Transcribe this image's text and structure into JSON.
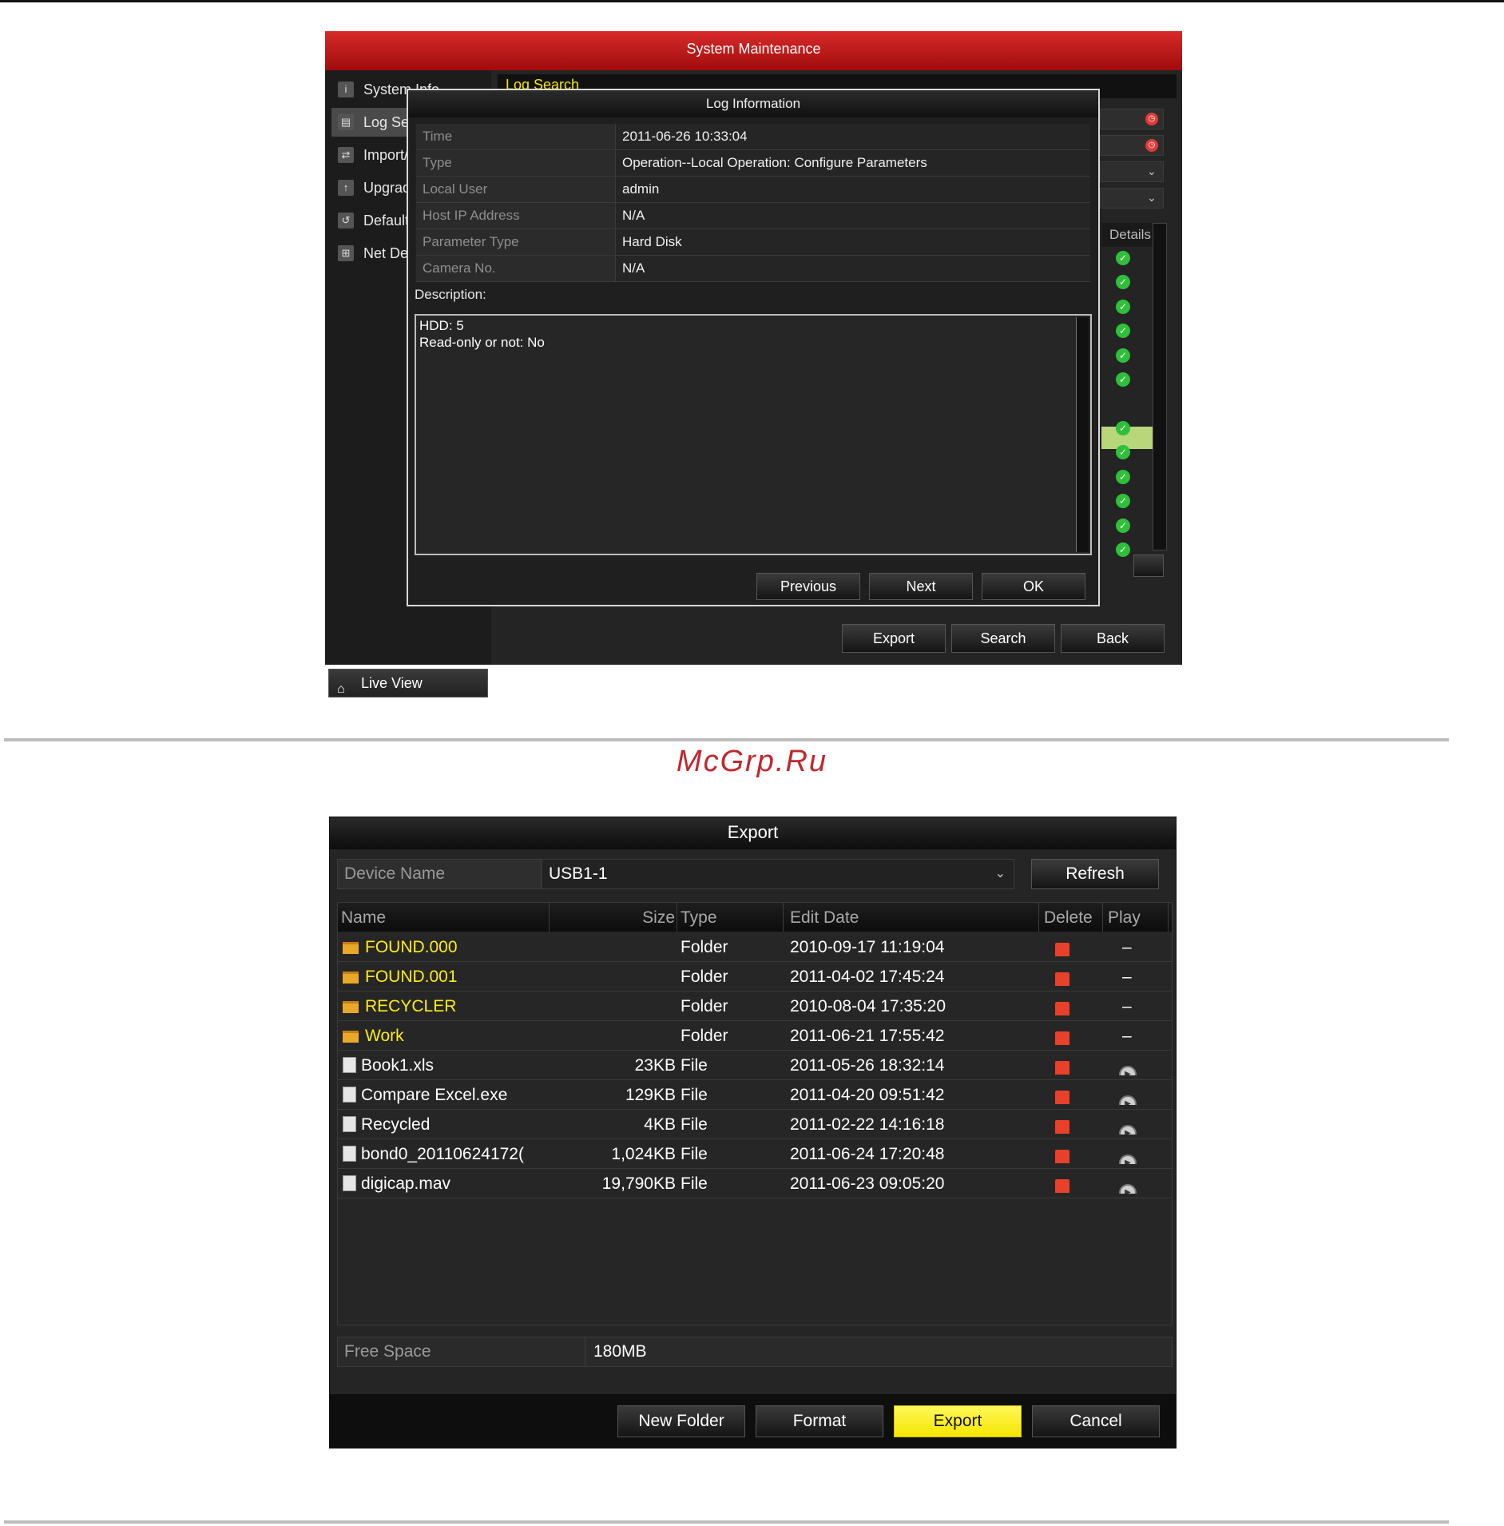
{
  "watermark": "McGrp.Ru",
  "system_maintenance": {
    "title": "System Maintenance",
    "sidebar": {
      "items": [
        {
          "label": "System Info",
          "icon": "info-icon"
        },
        {
          "label": "Log Search",
          "icon": "log-icon"
        },
        {
          "label": "Import/Export",
          "icon": "import-icon"
        },
        {
          "label": "Upgrade",
          "icon": "upgrade-icon"
        },
        {
          "label": "Default",
          "icon": "default-icon"
        },
        {
          "label": "Net Detect",
          "icon": "network-icon"
        }
      ],
      "live_view": "Live View"
    },
    "main_header": "Log Search",
    "details_header": "Details",
    "buttons": {
      "export": "Export",
      "search": "Search",
      "back": "Back"
    },
    "log_information": {
      "title": "Log Information",
      "fields": [
        {
          "key": "Time",
          "value": "2011-06-26 10:33:04"
        },
        {
          "key": "Type",
          "value": "Operation--Local Operation: Configure Parameters"
        },
        {
          "key": "Local User",
          "value": "admin"
        },
        {
          "key": "Host IP Address",
          "value": "N/A"
        },
        {
          "key": "Parameter Type",
          "value": "Hard Disk"
        },
        {
          "key": "Camera No.",
          "value": "N/A"
        }
      ],
      "description_label": "Description:",
      "description_lines": [
        "HDD: 5",
        "Read-only or not: No"
      ],
      "buttons": {
        "previous": "Previous",
        "next": "Next",
        "ok": "OK"
      }
    }
  },
  "export_dialog": {
    "title": "Export",
    "device_name_label": "Device Name",
    "device_name_value": "USB1-1",
    "refresh": "Refresh",
    "columns": {
      "name": "Name",
      "size": "Size",
      "type": "Type",
      "edit_date": "Edit Date",
      "delete": "Delete",
      "play": "Play"
    },
    "rows": [
      {
        "name": "FOUND.000",
        "size": "",
        "type": "Folder",
        "date": "2010-09-17 11:19:04",
        "kind": "folder"
      },
      {
        "name": "FOUND.001",
        "size": "",
        "type": "Folder",
        "date": "2011-04-02 17:45:24",
        "kind": "folder"
      },
      {
        "name": "RECYCLER",
        "size": "",
        "type": "Folder",
        "date": "2010-08-04 17:35:20",
        "kind": "folder"
      },
      {
        "name": "Work",
        "size": "",
        "type": "Folder",
        "date": "2011-06-21 17:55:42",
        "kind": "folder"
      },
      {
        "name": "Book1.xls",
        "size": "23KB",
        "type": "File",
        "date": "2011-05-26 18:32:14",
        "kind": "file"
      },
      {
        "name": "Compare Excel.exe",
        "size": "129KB",
        "type": "File",
        "date": "2011-04-20 09:51:42",
        "kind": "file"
      },
      {
        "name": "Recycled",
        "size": "4KB",
        "type": "File",
        "date": "2011-02-22 14:16:18",
        "kind": "file"
      },
      {
        "name": "bond0_20110624172(",
        "size": "1,024KB",
        "type": "File",
        "date": "2011-06-24 17:20:48",
        "kind": "file"
      },
      {
        "name": "digicap.mav",
        "size": "19,790KB",
        "type": "File",
        "date": "2011-06-23 09:05:20",
        "kind": "file"
      }
    ],
    "folder_play_symbol": "–",
    "free_space_label": "Free Space",
    "free_space_value": "180MB",
    "buttons": {
      "new_folder": "New Folder",
      "format": "Format",
      "export": "Export",
      "cancel": "Cancel"
    }
  }
}
